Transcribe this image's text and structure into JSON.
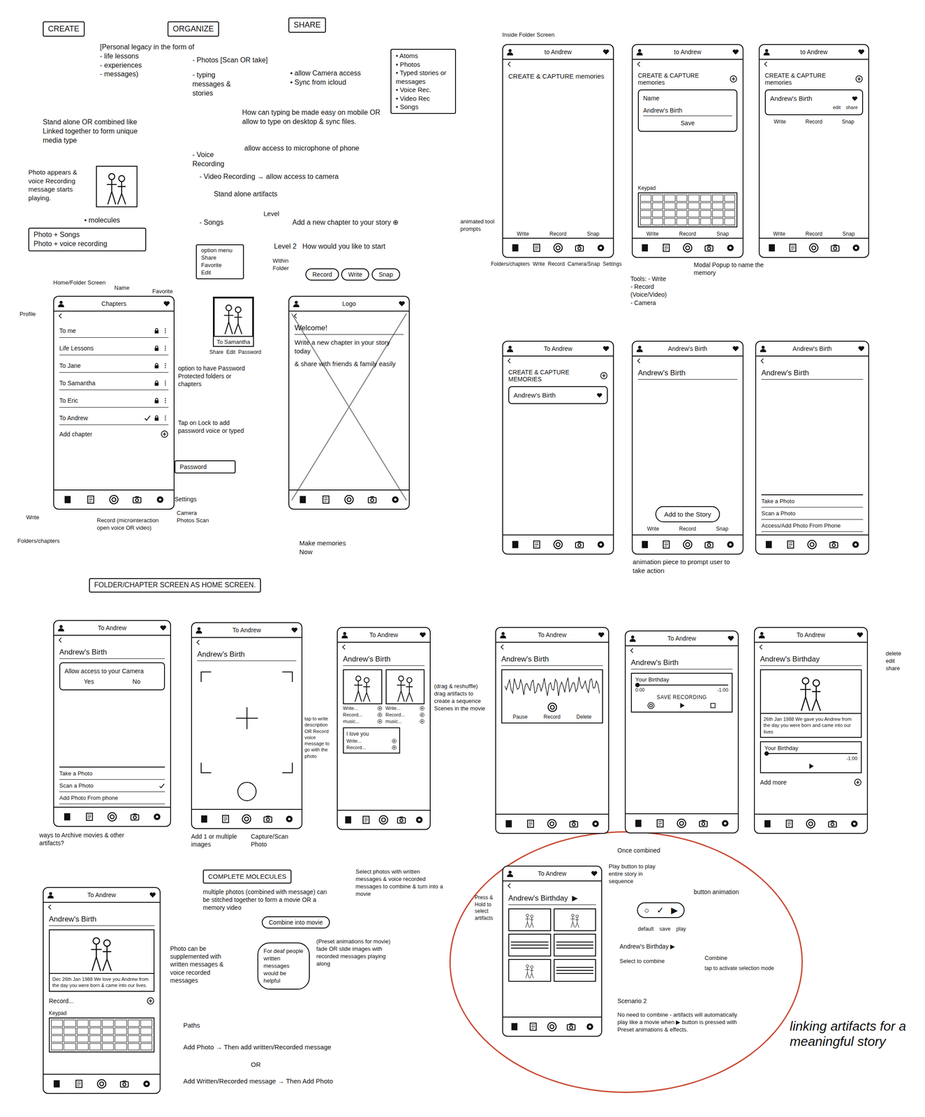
{
  "notes": [
    {
      "text": "CREATE",
      "kind": "boxed"
    },
    {
      "text": "ORGANIZE",
      "kind": "boxed"
    },
    {
      "text": "SHARE",
      "kind": "boxed"
    },
    {
      "text": "[Personal legacy in the form of\n- life lessons\n- experiences\n- messages)",
      "kind": "label"
    },
    {
      "text": "- Photos [Scan OR take]",
      "kind": "label"
    },
    {
      "text": "- typing messages & stories",
      "kind": "label"
    },
    {
      "text": "• allow Camera access\n• Sync from icloud",
      "kind": "label"
    },
    {
      "text": "How can typing be made easy on mobile OR allow to type on desktop & sync files.",
      "kind": "label"
    },
    {
      "text": "- Voice Recording",
      "kind": "label"
    },
    {
      "text": "allow access to microphone of phone",
      "kind": "label"
    },
    {
      "text": "- Video Recording → allow access to camera",
      "kind": "label"
    },
    {
      "text": "Stand alone artifacts",
      "kind": "label"
    },
    {
      "text": "- Songs",
      "kind": "label"
    },
    {
      "text": "• Atoms\n• Photos\n• Typed stories or messages\n• Voice Rec.\n• Video Rec\n• Songs",
      "kind": "boxed"
    },
    {
      "text": "Stand alone OR combined like Linked together to form unique media type",
      "kind": "label"
    },
    {
      "text": "Photo appears & voice Recording message starts playing.",
      "kind": "label"
    },
    {
      "text": "• molecules",
      "kind": "label"
    },
    {
      "text": "Photo + Songs\nPhoto + voice recording",
      "kind": "boxed"
    },
    {
      "text": "Level",
      "kind": "label"
    },
    {
      "text": "Add a new chapter to your story ⊕",
      "kind": "label"
    },
    {
      "text": "Level 2   How would you like to start",
      "kind": "label"
    },
    {
      "text": "Within Folder",
      "kind": "label"
    },
    {
      "text": "Record",
      "kind": "pill"
    },
    {
      "text": "Write",
      "kind": "pill"
    },
    {
      "text": "Snap",
      "kind": "pill"
    },
    {
      "text": "Home/Folder Screen",
      "kind": "label"
    },
    {
      "text": "Name",
      "kind": "label"
    },
    {
      "text": "Favorite",
      "kind": "label"
    },
    {
      "text": "Profile",
      "kind": "label"
    },
    {
      "text": "option menu\nShare\nFavorite\nEdit",
      "kind": "boxed"
    },
    {
      "text": "To Samantha",
      "kind": "photo"
    },
    {
      "text": "Share  Edit  Password",
      "kind": "label"
    },
    {
      "text": "option to have Password Protected folders or chapters",
      "kind": "label"
    },
    {
      "text": "Tap on Lock to add password voice or typed",
      "kind": "label"
    },
    {
      "text": "Password",
      "kind": "boxed"
    },
    {
      "text": "Settings",
      "kind": "label"
    },
    {
      "text": "Camera Photos Scan",
      "kind": "label"
    },
    {
      "text": "Record (microinteraction open voice OR video)",
      "kind": "label"
    },
    {
      "text": "Folders/chapters",
      "kind": "label"
    },
    {
      "text": "Write",
      "kind": "label"
    },
    {
      "text": "Make memories Now",
      "kind": "label"
    },
    {
      "text": "FOLDER/CHAPTER SCREEN AS HOME SCREEN.",
      "kind": "boxed"
    },
    {
      "text": "Inside Folder Screen",
      "kind": "label"
    },
    {
      "text": "animated tool prompts",
      "kind": "label"
    },
    {
      "text": "Folders/chapters  Write  Record  Camera/Snap  Settings",
      "kind": "label"
    },
    {
      "text": "Modal Popup to name the memory",
      "kind": "label"
    },
    {
      "text": "Tools: - Write\n- Record\n(Voice/Video)\n- Camera",
      "kind": "label"
    },
    {
      "text": "animation piece to prompt user to take action",
      "kind": "label"
    },
    {
      "text": "ways to Archive movies & other artifacts?",
      "kind": "label"
    },
    {
      "text": "Add 1 or multiple images",
      "kind": "label"
    },
    {
      "text": "Capture/Scan Photo",
      "kind": "label"
    },
    {
      "text": "(drag & reshuffle) drag artifacts to create a sequence Scenes in the movie",
      "kind": "label"
    },
    {
      "text": "tap to write description OR Record voice message to go with the photo",
      "kind": "label"
    },
    {
      "text": "delete\nedit\nshare",
      "kind": "label"
    },
    {
      "text": "COMPLETE MOLECULES",
      "kind": "boxed"
    },
    {
      "text": "multiple photos (combined with message) can be stitched together to form a movie OR a memory video",
      "kind": "label"
    },
    {
      "text": "Combine into movie",
      "kind": "pill"
    },
    {
      "text": "(Preset animations for movie) fade OR slide images with recorded messages playing along",
      "kind": "label"
    },
    {
      "text": "Select photos with written messages & voice recorded messages to combine & turn into a movie",
      "kind": "label"
    },
    {
      "text": "Photo can be supplemented with written messages & voice recorded messages",
      "kind": "label"
    },
    {
      "text": "For deaf people written messages would be helpful",
      "kind": "cloud"
    },
    {
      "text": "Paths",
      "kind": "label"
    },
    {
      "text": "Add Photo → Then add written/Recorded message",
      "kind": "label"
    },
    {
      "text": "OR",
      "kind": "label"
    },
    {
      "text": "Add Written/Recorded message → Then Add Photo",
      "kind": "label"
    },
    {
      "text": "Once combined",
      "kind": "label"
    },
    {
      "text": "Play button to play entire story in sequence",
      "kind": "label"
    },
    {
      "text": "button animation",
      "kind": "label"
    },
    {
      "text": "○   ✓   ▶",
      "kind": "pill"
    },
    {
      "text": "default    save    play",
      "kind": "label"
    },
    {
      "text": "Andrew's Birthday ▶",
      "kind": "label"
    },
    {
      "text": "Select to combine",
      "kind": "label"
    },
    {
      "text": "Combine",
      "kind": "label"
    },
    {
      "text": "tap to activate selection mode",
      "kind": "label"
    },
    {
      "text": "Press & Hold to select artifacts",
      "kind": "label"
    },
    {
      "text": "Scenario 2",
      "kind": "label"
    },
    {
      "text": "No need to combine - artifacts will automatically play like a movie when ▶ button is pressed with Preset animations & effects.",
      "kind": "label"
    },
    {
      "text": "linking artifacts for a meaningful story",
      "kind": "big"
    }
  ],
  "phones": [
    {
      "title": "Chapters",
      "crossed": false,
      "tab_labels": [],
      "elements": [
        {
          "kind": "row",
          "text": "To me",
          "checked": false
        },
        {
          "kind": "row",
          "text": "Life Lessons",
          "checked": false
        },
        {
          "kind": "row",
          "text": "To Jane",
          "checked": false
        },
        {
          "kind": "row",
          "text": "To Samantha",
          "checked": false
        },
        {
          "kind": "row",
          "text": "To Eric",
          "checked": false
        },
        {
          "kind": "row",
          "text": "To Andrew",
          "checked": true
        },
        {
          "kind": "add",
          "text": "Add chapter"
        }
      ]
    },
    {
      "title": "Logo",
      "crossed": true,
      "tab_labels": [],
      "elements": [
        {
          "kind": "heading",
          "text": "Welcome!"
        },
        {
          "kind": "text",
          "text": "Write a new chapter in your story today"
        },
        {
          "kind": "text",
          "text": "& share with friends & family easily"
        }
      ]
    },
    {
      "title": "to Andrew",
      "crossed": false,
      "tab_labels": [
        "Write",
        "Record",
        "Snap"
      ],
      "elements": [
        {
          "kind": "text",
          "text": "CREATE & CAPTURE memories"
        }
      ]
    },
    {
      "title": "to Andrew",
      "crossed": false,
      "tab_labels": [
        "Write",
        "Record",
        "Snap"
      ],
      "elements": [
        {
          "kind": "add",
          "text": "CREATE & CAPTURE memories"
        },
        {
          "kind": "dialog",
          "text": "Name",
          "value": "Andrew's Birth",
          "items": [
            "Save"
          ]
        },
        {
          "kind": "spacer"
        },
        {
          "kind": "keypad",
          "text": "Keypad"
        }
      ]
    },
    {
      "title": "to Andrew",
      "crossed": false,
      "tab_labels": [
        "Write",
        "Record",
        "Snap"
      ],
      "elements": [
        {
          "kind": "add",
          "text": "CREATE & CAPTURE memories"
        },
        {
          "kind": "card",
          "text": "Andrew's Birth",
          "items": [
            "edit",
            "share"
          ]
        },
        {
          "kind": "labels",
          "items": [
            "Write",
            "Record",
            "Snap"
          ]
        }
      ]
    },
    {
      "title": "To Andrew",
      "crossed": false,
      "tab_labels": [],
      "elements": [
        {
          "kind": "add",
          "text": "CREATE & CAPTURE MEMORIES"
        },
        {
          "kind": "card",
          "text": "Andrew's Birth",
          "items": []
        }
      ]
    },
    {
      "title": "Andrew's Birth",
      "crossed": false,
      "tab_labels": [],
      "elements": [
        {
          "kind": "heading",
          "text": "Andrew's Birth"
        },
        {
          "kind": "spacer"
        },
        {
          "kind": "button",
          "text": "Add to the Story"
        },
        {
          "kind": "labels",
          "items": [
            "Write",
            "Record",
            "Snap"
          ]
        }
      ]
    },
    {
      "title": "Andrew's Birth",
      "crossed": false,
      "tab_labels": [],
      "elements": [
        {
          "kind": "heading",
          "text": "Andrew's Birth"
        },
        {
          "kind": "spacer"
        },
        {
          "kind": "list",
          "items": [
            {
              "text": "Take a Photo",
              "checked": false
            },
            {
              "text": "Scan a Photo",
              "checked": false
            },
            {
              "text": "Access/Add Photo From Phone",
              "checked": false
            }
          ]
        }
      ]
    },
    {
      "title": "To Andrew",
      "crossed": false,
      "tab_labels": [],
      "elements": [
        {
          "kind": "heading",
          "text": "Andrew's Birth"
        },
        {
          "kind": "dialog",
          "text": "Allow access to your Camera",
          "items": [
            "Yes",
            "No"
          ]
        },
        {
          "kind": "spacer"
        },
        {
          "kind": "list",
          "items": [
            {
              "text": "Take a Photo",
              "checked": false
            },
            {
              "text": "Scan a Photo",
              "checked": true
            },
            {
              "text": "Add Photo From phone",
              "checked": false
            }
          ]
        }
      ]
    },
    {
      "title": "To Andrew",
      "crossed": false,
      "tab_labels": [],
      "elements": [
        {
          "kind": "heading",
          "text": "Andrew's Birth"
        },
        {
          "kind": "viewfinder"
        }
      ]
    },
    {
      "title": "To Andrew",
      "crossed": false,
      "tab_labels": [],
      "elements": [
        {
          "kind": "heading",
          "text": "Andrew's Birth"
        },
        {
          "kind": "photos",
          "items": [
            {
              "lines": [
                "Write...",
                "Record...",
                "music..."
              ]
            },
            {
              "lines": [
                "Write...",
                "Record...",
                "music..."
              ]
            }
          ]
        },
        {
          "kind": "note",
          "text": "I love you",
          "lines": [
            "Write...",
            "Record..."
          ]
        }
      ]
    },
    {
      "title": "To Andrew",
      "crossed": false,
      "tab_labels": [],
      "elements": [
        {
          "kind": "heading",
          "text": "Andrew's Birth"
        },
        {
          "kind": "waveform",
          "items": [
            "Pause",
            "Record",
            "Delete"
          ]
        }
      ]
    },
    {
      "title": "To Andrew",
      "crossed": false,
      "tab_labels": [],
      "elements": [
        {
          "kind": "heading",
          "text": "Andrew's Birth"
        },
        {
          "kind": "audio",
          "text": "Your Birthday",
          "start": "0:00",
          "end": "-1:00",
          "action": "SAVE RECORDING"
        }
      ]
    },
    {
      "title": "To Andrew",
      "crossed": false,
      "tab_labels": [],
      "elements": [
        {
          "kind": "heading",
          "text": "Andrew's Birthday"
        },
        {
          "kind": "photo",
          "caption": "26th Jan 1988\nWe gave you Andrew from the day you were born and came into our lives"
        },
        {
          "kind": "audio",
          "text": "Your Birthday",
          "end": "-1:00"
        },
        {
          "kind": "add",
          "text": "Add more"
        }
      ]
    },
    {
      "title": "To Andrew",
      "crossed": false,
      "tab_labels": [],
      "elements": [
        {
          "kind": "heading",
          "text": "Andrew's Birth"
        },
        {
          "kind": "photo",
          "caption": "Dec 26th Jan 1988\nWe love you Andrew from the day you were born & came into our lives."
        },
        {
          "kind": "add",
          "text": "Record..."
        },
        {
          "kind": "keypad",
          "text": "Keypad"
        }
      ]
    },
    {
      "title": "To Andrew",
      "crossed": false,
      "tab_labels": [],
      "elements": [
        {
          "kind": "heading",
          "text": "Andrew's Birthday",
          "play": "▶"
        },
        {
          "kind": "grid"
        }
      ]
    }
  ]
}
